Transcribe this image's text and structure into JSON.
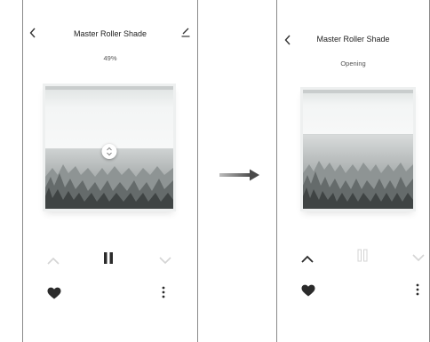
{
  "before": {
    "title": "Master Roller Shade",
    "status": "49%",
    "shade_position": 0.49
  },
  "after": {
    "title": "Master Roller Shade",
    "status": "Opening"
  },
  "icons": {
    "back": "chevron-left-icon",
    "edit": "pencil-icon",
    "up": "chevron-up-icon",
    "pause": "pause-icon",
    "down": "chevron-down-icon",
    "favorite": "heart-icon",
    "more": "more-vertical-icon",
    "transition": "arrow-right-icon"
  },
  "colors": {
    "active": "#2b2b2b",
    "disabled": "#d4d4d4"
  }
}
